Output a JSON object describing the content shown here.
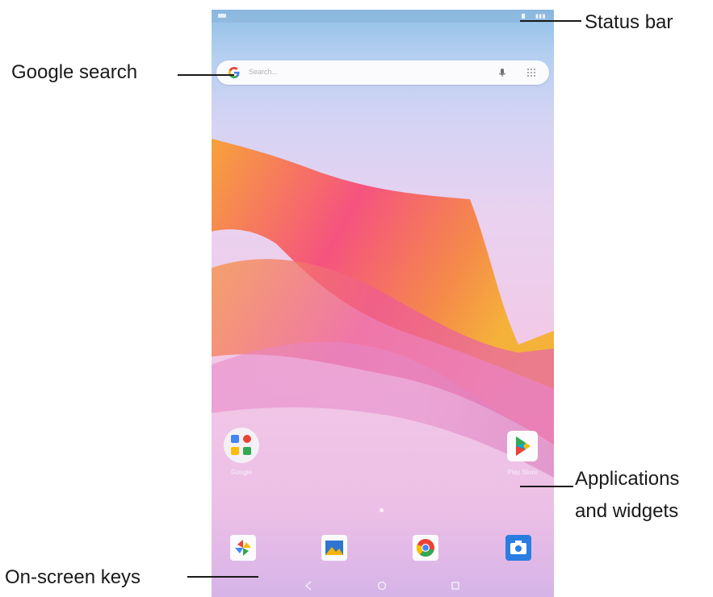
{
  "screen": {
    "search_placeholder": "Search...",
    "apps": [
      {
        "icon": "google-folder-icon",
        "label": "Google"
      },
      {
        "icon": "play-store-icon",
        "label": "Play Store"
      }
    ],
    "dock": [
      "photos-icon",
      "gallery-icon",
      "chrome-icon",
      "camera-icon"
    ],
    "nav_keys": [
      "back-key-icon",
      "home-key-icon",
      "recents-key-icon"
    ]
  },
  "annotations": {
    "status_bar": "Status bar",
    "google_search": "Google search",
    "apps_line1": "Applications",
    "apps_line2": "and widgets",
    "onscreen_keys": "On-screen keys"
  },
  "colors": {
    "wallpaper_orange": "#f6a13a",
    "wallpaper_pink": "#f2558c",
    "wallpaper_lilac": "#e6b9e8",
    "annotation_text": "#1a1a1a"
  }
}
